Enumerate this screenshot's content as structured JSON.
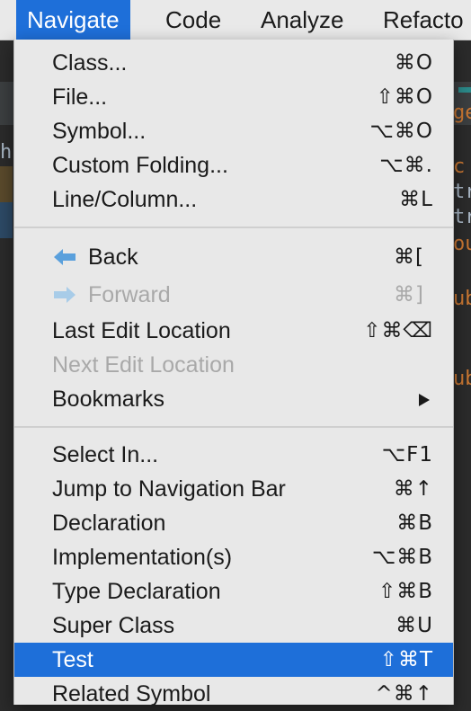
{
  "menubar": {
    "items": [
      {
        "label": "Navigate"
      },
      {
        "label": "Code"
      },
      {
        "label": "Analyze"
      },
      {
        "label": "Refacto"
      }
    ]
  },
  "editor": {
    "left_fragment": "h",
    "code_fragments": [
      "ge",
      "c",
      "tr",
      "tr",
      "ou",
      "ub",
      "ub"
    ]
  },
  "menu": {
    "group1": [
      {
        "label": "Class...",
        "shortcut": "⌘O"
      },
      {
        "label": "File...",
        "shortcut": "⇧⌘O"
      },
      {
        "label": "Symbol...",
        "shortcut": "⌥⌘O"
      },
      {
        "label": "Custom Folding...",
        "shortcut": "⌥⌘."
      },
      {
        "label": "Line/Column...",
        "shortcut": "⌘L"
      }
    ],
    "group2": [
      {
        "label": "Back",
        "shortcut": "⌘[",
        "icon": "arrow-left-icon"
      },
      {
        "label": "Forward",
        "shortcut": "⌘]",
        "icon": "arrow-right-icon"
      },
      {
        "label": "Last Edit Location",
        "shortcut": "⇧⌘⌫"
      },
      {
        "label": "Next Edit Location",
        "shortcut": ""
      },
      {
        "label": "Bookmarks",
        "shortcut": ""
      }
    ],
    "group3": [
      {
        "label": "Select In...",
        "shortcut": "⌥F1"
      },
      {
        "label": "Jump to Navigation Bar",
        "shortcut": "⌘↑"
      },
      {
        "label": "Declaration",
        "shortcut": "⌘B"
      },
      {
        "label": "Implementation(s)",
        "shortcut": "⌥⌘B"
      },
      {
        "label": "Type Declaration",
        "shortcut": "⇧⌘B"
      },
      {
        "label": "Super Class",
        "shortcut": "⌘U"
      },
      {
        "label": "Test",
        "shortcut": "⇧⌘T"
      },
      {
        "label": "Related Symbol",
        "shortcut": "^⌘↑"
      }
    ]
  },
  "colors": {
    "accent": "#1e6fd9",
    "menu_bg": "#e8e8e8",
    "disabled": "#a9a9a9",
    "arrow_icon": "#5aa0dc",
    "code_orange": "#cc7832",
    "code_blue": "#a9b7c6"
  }
}
